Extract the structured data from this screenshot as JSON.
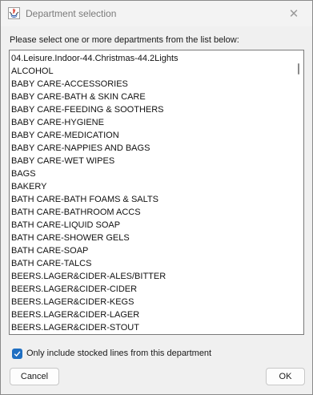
{
  "window": {
    "title": "Department selection",
    "app_icon": "java-app-icon",
    "close_icon": "close-icon"
  },
  "prompt": "Please select one or more departments from the list below:",
  "departments": [
    "04.Leisure.Indoor-44.Christmas-44.2Lights",
    "ALCOHOL",
    "BABY CARE-ACCESSORIES",
    "BABY CARE-BATH & SKIN CARE",
    "BABY CARE-FEEDING & SOOTHERS",
    "BABY CARE-HYGIENE",
    "BABY CARE-MEDICATION",
    "BABY CARE-NAPPIES AND BAGS",
    "BABY CARE-WET WIPES",
    "BAGS",
    "BAKERY",
    "BATH CARE-BATH FOAMS & SALTS",
    "BATH CARE-BATHROOM ACCS",
    "BATH CARE-LIQUID SOAP",
    "BATH CARE-SHOWER GELS",
    "BATH CARE-SOAP",
    "BATH CARE-TALCS",
    "BEERS.LAGER&CIDER-ALES/BITTER",
    "BEERS.LAGER&CIDER-CIDER",
    "BEERS.LAGER&CIDER-KEGS",
    "BEERS.LAGER&CIDER-LAGER",
    "BEERS.LAGER&CIDER-STOUT"
  ],
  "stocked_only": {
    "label": "Only include stocked lines from this department",
    "checked": true
  },
  "buttons": {
    "cancel": "Cancel",
    "ok": "OK"
  },
  "colors": {
    "checkbox_accent": "#1f6fc2",
    "window_bg": "#f0f0f0",
    "list_bg": "#ffffff"
  }
}
